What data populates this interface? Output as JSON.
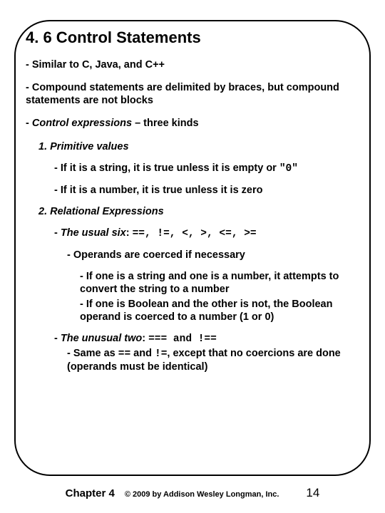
{
  "title": "4. 6 Control Statements",
  "bullets": {
    "similar": "- Similar to C, Java, and C++",
    "compound": "- Compound statements are delimited by braces, but compound statements are not blocks",
    "control_lead": "- ",
    "control_ital": "Control expressions",
    "control_tail": " – three kinds",
    "prim_lead": "1. ",
    "prim_ital": "Primitive values",
    "prim_string_a": "- If it is a string, it is true unless it is empty or ",
    "prim_string_code": "\"0\"",
    "prim_number": "- If it is a number, it is true unless it is zero",
    "rel_lead": "2. ",
    "rel_ital": "Relational Expressions",
    "usual_lead": "- ",
    "usual_ital": "The usual six",
    "usual_mid": ": ",
    "usual_code": "==, !=, <, >, <=, >=",
    "coerced": "- Operands are coerced if necessary",
    "coerce_str": "- If one is a string and one is a number, it attempts to convert the string to a number",
    "coerce_bool": "- If one is Boolean and the other is not, the Boolean operand is coerced to a number (1 or 0)",
    "unusual_lead": "- ",
    "unusual_ital": "The unusual two",
    "unusual_mid": ": ",
    "unusual_code": "=== and !==",
    "same_a": "- Same as ",
    "same_code1": "==",
    "same_b": " and ",
    "same_code2": "!=",
    "same_c": ", except that no coercions are done (operands must be identical)"
  },
  "footer": {
    "chapter": "Chapter 4",
    "copyright": "© 2009 by Addison Wesley Longman, Inc.",
    "page": "14"
  }
}
